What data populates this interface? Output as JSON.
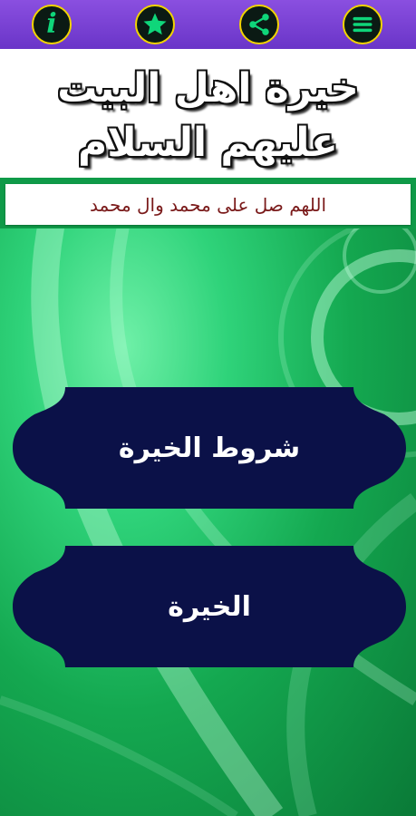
{
  "toolbar": {
    "buttons": [
      {
        "icon": "menu-icon"
      },
      {
        "icon": "share-icon"
      },
      {
        "icon": "star-icon"
      },
      {
        "icon": "info-icon"
      }
    ],
    "accent": "#f2d400",
    "bar_color": "#7a42d8"
  },
  "header": {
    "title_line1": "خيرة اهل البيت",
    "title_line2": "عليهم السلام"
  },
  "banner": {
    "text": "اللهم صل على محمد وال محمد"
  },
  "menu": {
    "buttons": [
      {
        "label": "شروط الخيرة"
      },
      {
        "label": "الخيرة"
      }
    ],
    "button_color": "#0b1148"
  }
}
